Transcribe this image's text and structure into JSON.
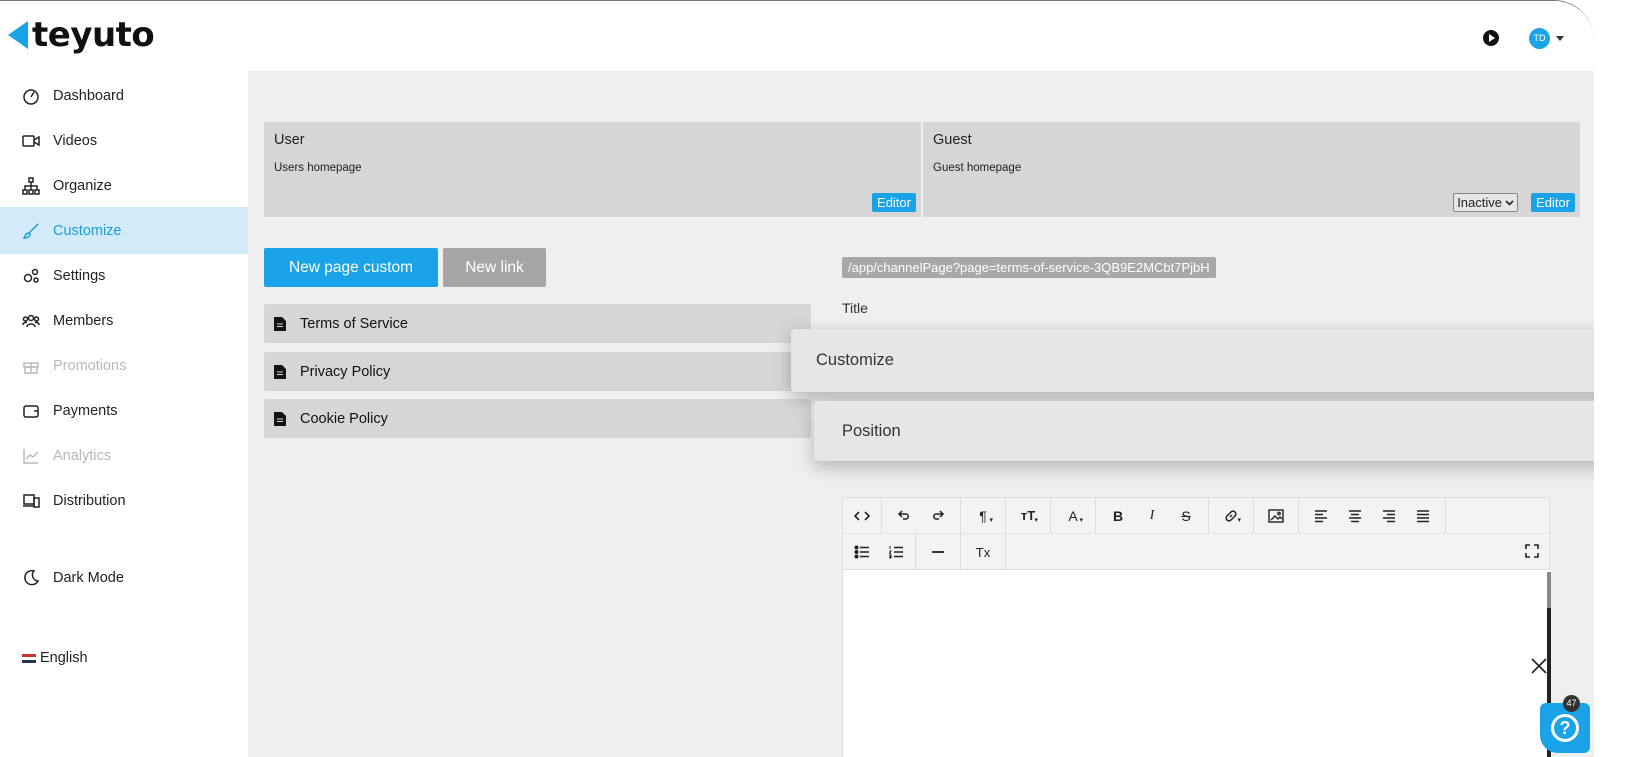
{
  "header": {
    "logo_text": "teyuto",
    "avatar_initials": "TD"
  },
  "sidebar": {
    "items": [
      {
        "label": "Dashboard",
        "icon": "dashboard-icon"
      },
      {
        "label": "Videos",
        "icon": "video-camera-icon"
      },
      {
        "label": "Organize",
        "icon": "sitemap-icon"
      },
      {
        "label": "Customize",
        "icon": "brush-icon"
      },
      {
        "label": "Settings",
        "icon": "gears-icon"
      },
      {
        "label": "Members",
        "icon": "users-icon"
      },
      {
        "label": "Promotions",
        "icon": "gift-icon"
      },
      {
        "label": "Payments",
        "icon": "wallet-icon"
      },
      {
        "label": "Analytics",
        "icon": "chart-line-icon"
      },
      {
        "label": "Distribution",
        "icon": "devices-icon"
      }
    ],
    "active_item": "Customize",
    "disabled_items": [
      "Promotions",
      "Analytics"
    ],
    "dark_mode_label": "Dark Mode",
    "language_label": "English"
  },
  "homepages": {
    "user": {
      "title": "User",
      "subtitle": "Users homepage",
      "editor_label": "Editor"
    },
    "guest": {
      "title": "Guest",
      "subtitle": "Guest homepage",
      "status_value": "Inactive",
      "editor_label": "Editor"
    }
  },
  "actions": {
    "new_page_label": "New page custom",
    "new_link_label": "New link"
  },
  "pages": [
    {
      "label": "Terms of Service"
    },
    {
      "label": "Privacy Policy"
    },
    {
      "label": "Cookie Policy"
    }
  ],
  "detail": {
    "url": "/app/channelPage?page=terms-of-service-3QB9E2MCbt7PjbH",
    "title_label": "Title"
  },
  "popups": {
    "customize_label": "Customize",
    "position_label": "Position"
  },
  "editor_toolbar": {
    "paragraph_glyph": "¶",
    "font_size_glyph": "тT",
    "font_color_glyph": "A",
    "bold_glyph": "B",
    "italic_glyph": "I",
    "strike_glyph": "S",
    "clear_format_glyph": "Tx"
  },
  "help": {
    "badge_count": "47"
  },
  "colors": {
    "accent": "#1aa3e8",
    "active_bg": "#d3ebf8",
    "card_bg": "#d6d6d6",
    "main_bg": "#efefef"
  }
}
